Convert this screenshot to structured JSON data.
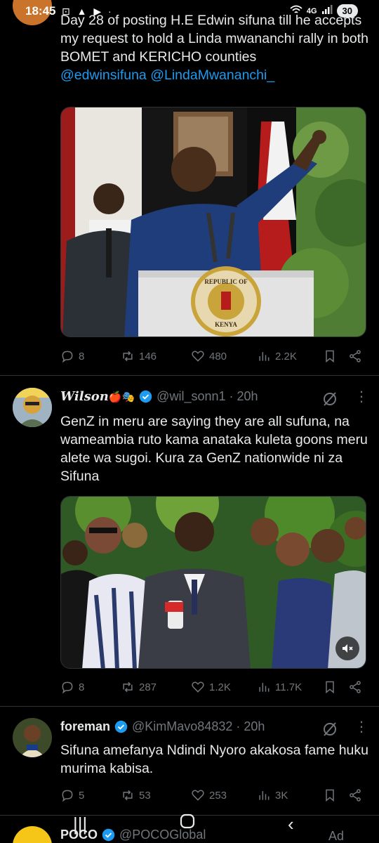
{
  "status": {
    "time": "18:45",
    "network": "4G",
    "battery": "30"
  },
  "tweets": [
    {
      "text": "Day 28 of posting H.E Edwin sifuna till he accepts my request to hold a Linda mwananchi rally in both BOMET and KERICHO counties",
      "mentions": "@edwinsifuna @LindaMwananchi_",
      "seal_top": "REPUBLIC OF",
      "seal_bottom": "KENYA",
      "stats": {
        "replies": "8",
        "reposts": "146",
        "likes": "480",
        "views": "2.2K"
      }
    },
    {
      "name": "Wilson",
      "name_emoji": "🍎🎭",
      "handle": "@wil_sonn1 · 20h",
      "text": "GenZ in meru are saying they are all sufuna, na wameambia ruto kama anataka kuleta goons meru alete wa sugoi. Kura za GenZ nationwide ni za Sifuna",
      "stats": {
        "replies": "8",
        "reposts": "287",
        "likes": "1.2K",
        "views": "11.7K"
      }
    },
    {
      "name": "foreman",
      "handle": "@KimMavo84832 · 20h",
      "text": "Sifuna amefanya Ndindi Nyoro akakosa fame huku murima kabisa.",
      "stats": {
        "replies": "5",
        "reposts": "53",
        "likes": "253",
        "views": "3K"
      }
    },
    {
      "name": "POCO",
      "handle": "@POCOGlobal",
      "ad_label": "Ad"
    }
  ],
  "colors": {
    "accent": "#1d9bf0",
    "muted": "#71767b",
    "background": "#000000"
  }
}
